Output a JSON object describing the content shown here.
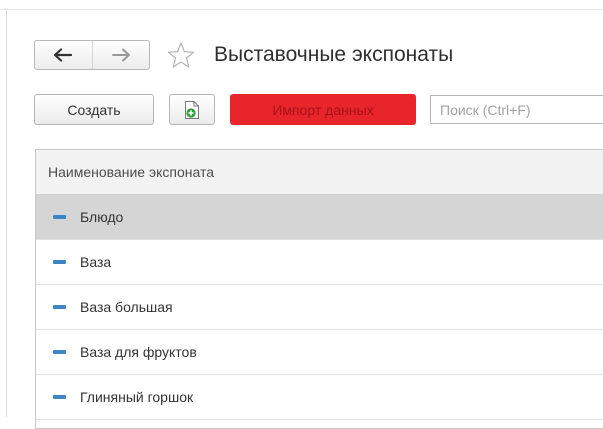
{
  "header": {
    "title": "Выставочные экспонаты",
    "back_icon": "arrow-left-icon",
    "forward_icon": "arrow-right-icon",
    "favorite_icon": "star-outline-icon"
  },
  "toolbar": {
    "create_label": "Создать",
    "add_icon": "document-add-icon",
    "import_label": "Импорт данных",
    "import_color": "#e8252b",
    "search_placeholder": "Поиск (Ctrl+F)"
  },
  "list": {
    "column_header": "Наименование экспоната",
    "item_icon": "dash-icon",
    "item_icon_color": "#3d86c6",
    "items": [
      {
        "label": "Блюдо",
        "selected": true
      },
      {
        "label": "Ваза",
        "selected": false
      },
      {
        "label": "Ваза большая",
        "selected": false
      },
      {
        "label": "Ваза для фруктов",
        "selected": false
      },
      {
        "label": "Глиняный горшок",
        "selected": false
      }
    ]
  }
}
